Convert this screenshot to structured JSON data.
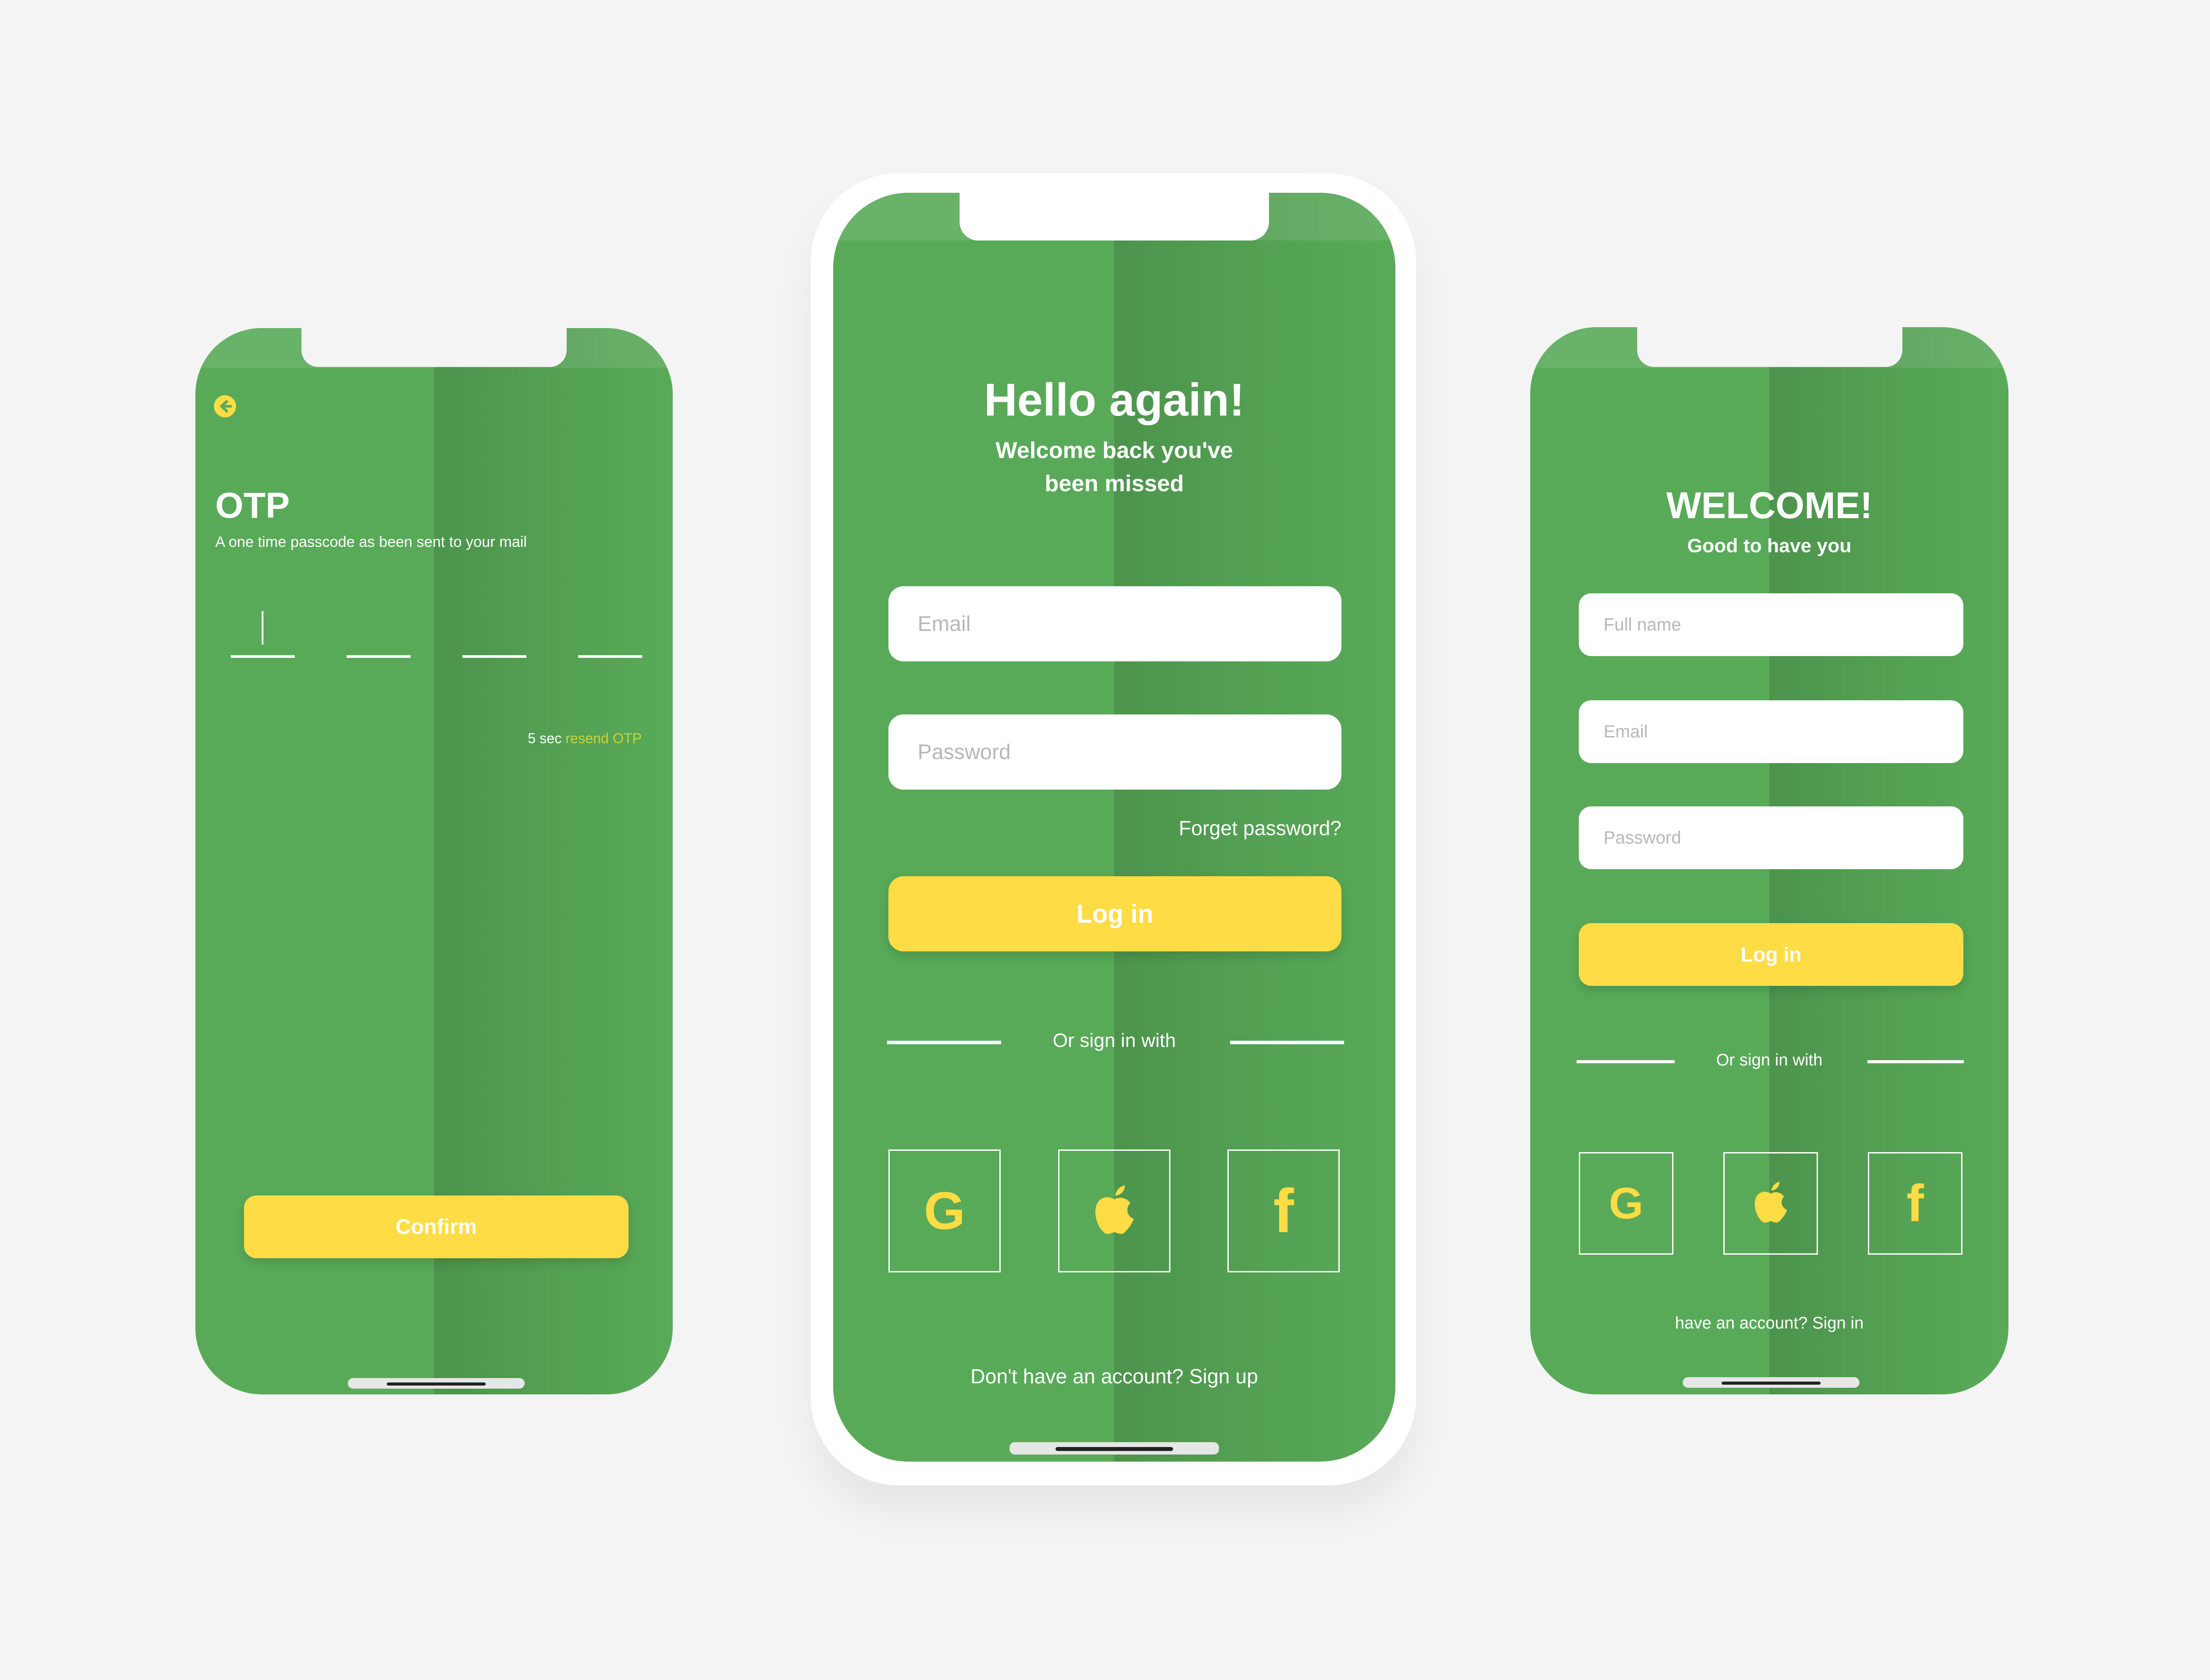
{
  "colors": {
    "background": "#f4f4f4",
    "phone_green": "#58aa58",
    "accent_yellow": "#fddc45",
    "text_white": "#ffffff"
  },
  "otp_screen": {
    "back_icon": "back-arrow-icon",
    "title": "OTP",
    "subtitle": "A one time passcode as been sent to your mail",
    "timer": "5 sec",
    "resend_label": "resend OTP",
    "confirm_label": "Confirm"
  },
  "login_screen": {
    "title": "Hello again!",
    "subtitle_line1": "Welcome back you've",
    "subtitle_line2": "been missed",
    "email_placeholder": "Email",
    "password_placeholder": "Password",
    "forgot_label": "Forget password?",
    "login_label": "Log in",
    "divider_label": "Or sign in with",
    "social": {
      "google": "G",
      "apple": "apple-icon",
      "facebook": "f"
    },
    "footer_text": "Don't have an account? Sign up"
  },
  "signup_screen": {
    "title": "WELCOME!",
    "subtitle": "Good to have you",
    "fullname_placeholder": "Full name",
    "email_placeholder": "Email",
    "password_placeholder": "Password",
    "login_label": "Log in",
    "divider_label": "Or sign in with",
    "social": {
      "google": "G",
      "apple": "apple-icon",
      "facebook": "f"
    },
    "footer_text": "have an account? Sign in"
  }
}
